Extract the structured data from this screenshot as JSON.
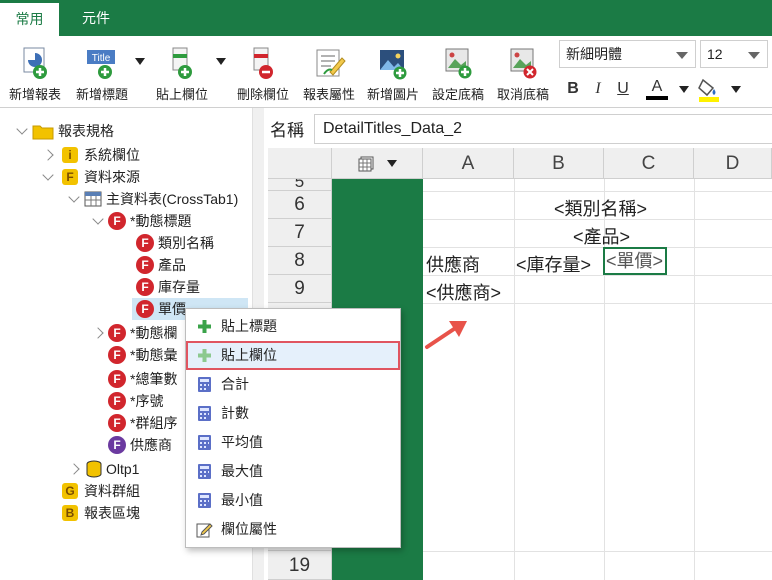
{
  "tabs": [
    {
      "label": "常用"
    },
    {
      "label": "元件"
    }
  ],
  "ribbon": {
    "buttons": [
      {
        "label": "新增報表",
        "icon": "new-report-icon"
      },
      {
        "label": "新增標題",
        "icon": "new-title-icon"
      },
      {
        "label": "貼上欄位",
        "icon": "paste-field-icon"
      },
      {
        "label": "刪除欄位",
        "icon": "delete-field-icon"
      },
      {
        "label": "報表屬性",
        "icon": "report-properties-icon"
      },
      {
        "label": "新增圖片",
        "icon": "add-image-icon"
      },
      {
        "label": "設定底稿",
        "icon": "set-background-icon"
      },
      {
        "label": "取消底稿",
        "icon": "cancel-background-icon"
      }
    ],
    "font_name": "新細明體",
    "font_size": "12",
    "bold": "B",
    "italic": "I",
    "underline": "U",
    "font_color_glyph": "A",
    "colors": {
      "accent": "#1b7b45",
      "field_red": "#d1262d",
      "field_purple": "#6b3aa0",
      "highlight_yellow": "#fff200"
    }
  },
  "tree": {
    "root": "報表規格",
    "system_fields": "系統欄位",
    "data_source": "資料來源",
    "main_table": "主資料表(CrossTab1)",
    "dynamic_title": "*動態標題",
    "dynamic_title_children": [
      "類別名稱",
      "產品",
      "庫存量",
      "單價"
    ],
    "other_nodes": [
      "*動態欄",
      "*動態彙",
      "*總筆數",
      "*序號",
      "*群組序"
    ],
    "supplier": "供應商",
    "oltp": "Oltp1",
    "data_groups": "資料群組",
    "report_sections": "報表區塊",
    "icon_letters": {
      "field": "F",
      "group": "G",
      "block": "B",
      "system": "i"
    }
  },
  "name_bar": {
    "label": "名稱",
    "value": "DetailTitles_Data_2"
  },
  "grid": {
    "col_headers": [
      "A",
      "B",
      "C",
      "D"
    ],
    "row_numbers": [
      "5",
      "6",
      "7",
      "8",
      "9",
      "19"
    ],
    "cells": {
      "r6": "<類別名稱>",
      "r7": "<產品>",
      "r8a": "供應商",
      "r8b": "<庫存量>",
      "r8c": "<單價>",
      "r9a": "<供應商>"
    }
  },
  "context_menu": {
    "items": [
      {
        "label": "貼上標題",
        "icon": "plus-icon"
      },
      {
        "label": "貼上欄位",
        "icon": "plus-icon"
      },
      {
        "label": "合計",
        "icon": "calculator-icon"
      },
      {
        "label": "計數",
        "icon": "calculator-icon"
      },
      {
        "label": "平均值",
        "icon": "calculator-icon"
      },
      {
        "label": "最大值",
        "icon": "calculator-icon"
      },
      {
        "label": "最小值",
        "icon": "calculator-icon"
      },
      {
        "label": "欄位屬性",
        "icon": "edit-icon"
      }
    ],
    "highlighted": "貼上欄位"
  }
}
